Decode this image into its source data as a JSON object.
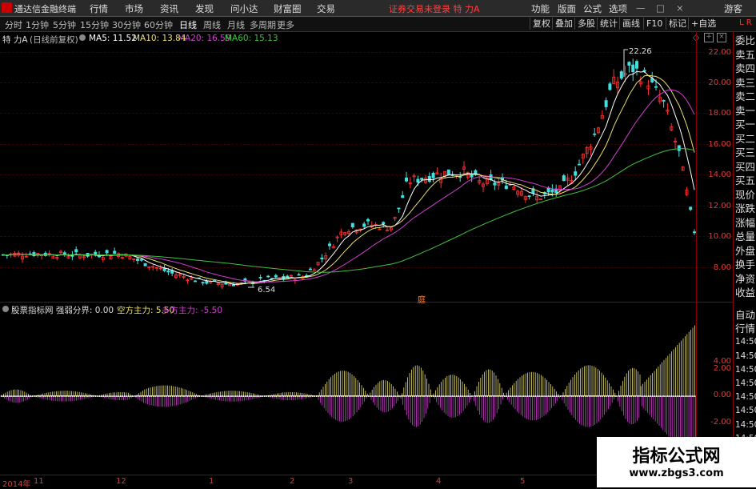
{
  "app": {
    "title": "通达信金融终端",
    "login_status": "证券交易未登录 特 力A"
  },
  "menu": [
    "行情",
    "市场",
    "资讯",
    "发现",
    "问小达",
    "财富圈",
    "交易"
  ],
  "topright": [
    "功能",
    "版面",
    "公式",
    "选项",
    "游客"
  ],
  "timeframes": [
    "分时",
    "1分钟",
    "5分钟",
    "15分钟",
    "30分钟",
    "60分钟",
    "日线",
    "周线",
    "月线",
    "多周期",
    "更多"
  ],
  "active_timeframe": "日线",
  "toolbar_right": [
    "复权",
    "叠加",
    "多股",
    "统计",
    "画线",
    "F10",
    "标记",
    "+自选"
  ],
  "stock": {
    "name": "特 力A",
    "adjust": "(日线前复权)"
  },
  "ma": [
    {
      "label": "MA5: 11.52",
      "color": "#ffffff"
    },
    {
      "label": "MA10: 13.84",
      "color": "#e8e070"
    },
    {
      "label": "MA20: 16.59",
      "color": "#d040d0"
    },
    {
      "label": "MA60: 15.13",
      "color": "#40c040"
    }
  ],
  "price_axis": [
    "22.00",
    "20.00",
    "18.00",
    "16.00",
    "14.00",
    "12.00",
    "10.00",
    "8.00"
  ],
  "high_label": "22.26",
  "low_label": "6.54",
  "indicator": {
    "name": "股票指标网 强弱分界: 0.00",
    "items": [
      {
        "label": "空方主力: 5.50",
        "color": "#e8e070"
      },
      {
        "label": "多方主力: -5.50",
        "color": "#d040d0"
      }
    ],
    "axis": [
      "4.00",
      "2.00",
      "0.00",
      "-2.00"
    ]
  },
  "x_axis": [
    "2014年",
    "11",
    "12",
    "1",
    "2",
    "3",
    "4",
    "5"
  ],
  "right_panel_top": [
    "委比",
    "卖五",
    "卖四",
    "卖三",
    "卖二",
    "卖一",
    "买一",
    "买二",
    "买三",
    "买四",
    "买五",
    "现价",
    "涨跌",
    "涨幅",
    "总量",
    "外盘",
    "换手",
    "净资",
    "收益"
  ],
  "right_panel_bottom": [
    "自动",
    "行情",
    "14:50",
    "14:50",
    "14:50",
    "14:50",
    "14:50",
    "14:50",
    "14:50",
    "14:50",
    "14:50"
  ],
  "ding_marker": "庭",
  "watermark": {
    "title": "指标公式网",
    "url": "www.zbgs3.com"
  },
  "colors": {
    "up": "#ff3030",
    "down": "#40e0e0",
    "axis": "#d04040",
    "ma60": "#40c040"
  }
}
